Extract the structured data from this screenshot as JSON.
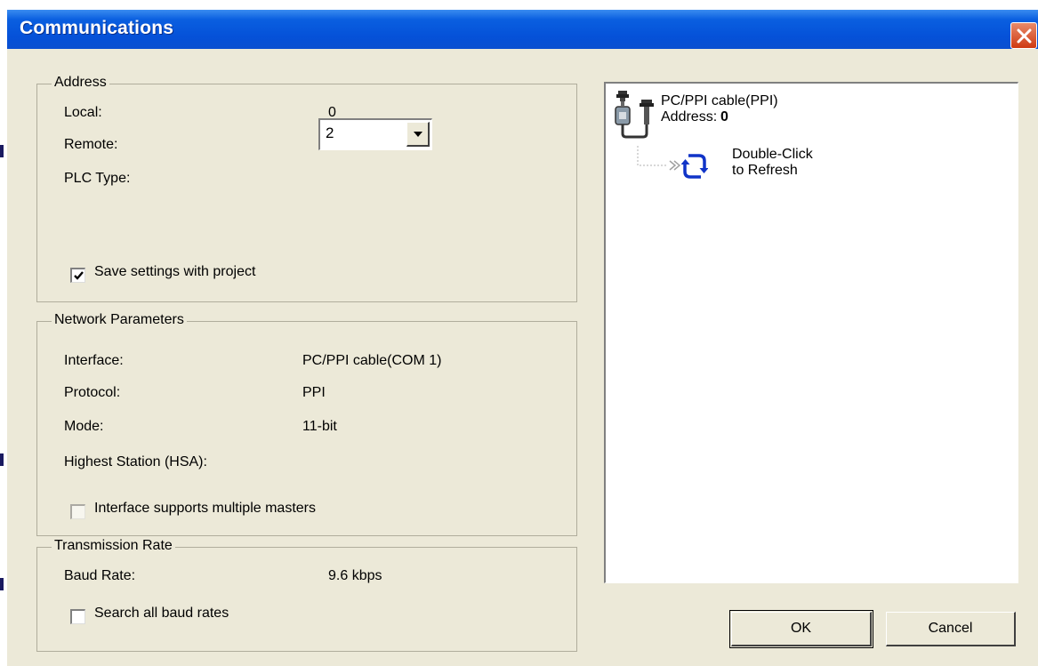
{
  "window": {
    "title": "Communications"
  },
  "address": {
    "group_title": "Address",
    "local_label": "Local:",
    "local_value": "0",
    "remote_label": "Remote:",
    "remote_value": "2",
    "plc_type_label": "PLC Type:",
    "save_settings_label": "Save settings with project",
    "save_settings_checked": true
  },
  "network": {
    "group_title": "Network Parameters",
    "interface_label": "Interface:",
    "interface_value": "PC/PPI cable(COM 1)",
    "protocol_label": "Protocol:",
    "protocol_value": "PPI",
    "mode_label": "Mode:",
    "mode_value": "11-bit",
    "hsa_label": "Highest Station (HSA):",
    "multi_master_label": "Interface supports multiple masters",
    "multi_master_checked": false
  },
  "transmission": {
    "group_title": "Transmission Rate",
    "baud_label": "Baud Rate:",
    "baud_value": "9.6 kbps",
    "search_label": "Search all baud rates",
    "search_checked": false
  },
  "tree": {
    "cable_name": "PC/PPI cable(PPI)",
    "address_label": "Address: ",
    "address_value": "0",
    "refresh_line1": "Double-Click",
    "refresh_line2": "to Refresh"
  },
  "buttons": {
    "ok": "OK",
    "cancel": "Cancel"
  },
  "icons": [
    "close-icon",
    "dropdown-arrow-icon",
    "checkmark-icon",
    "cable-connector-icon",
    "refresh-icon"
  ],
  "colors": {
    "titlebar": "#0551d8",
    "dialog_bg": "#ece9d8",
    "close": "#cf3a12",
    "refresh": "#1034c8"
  }
}
